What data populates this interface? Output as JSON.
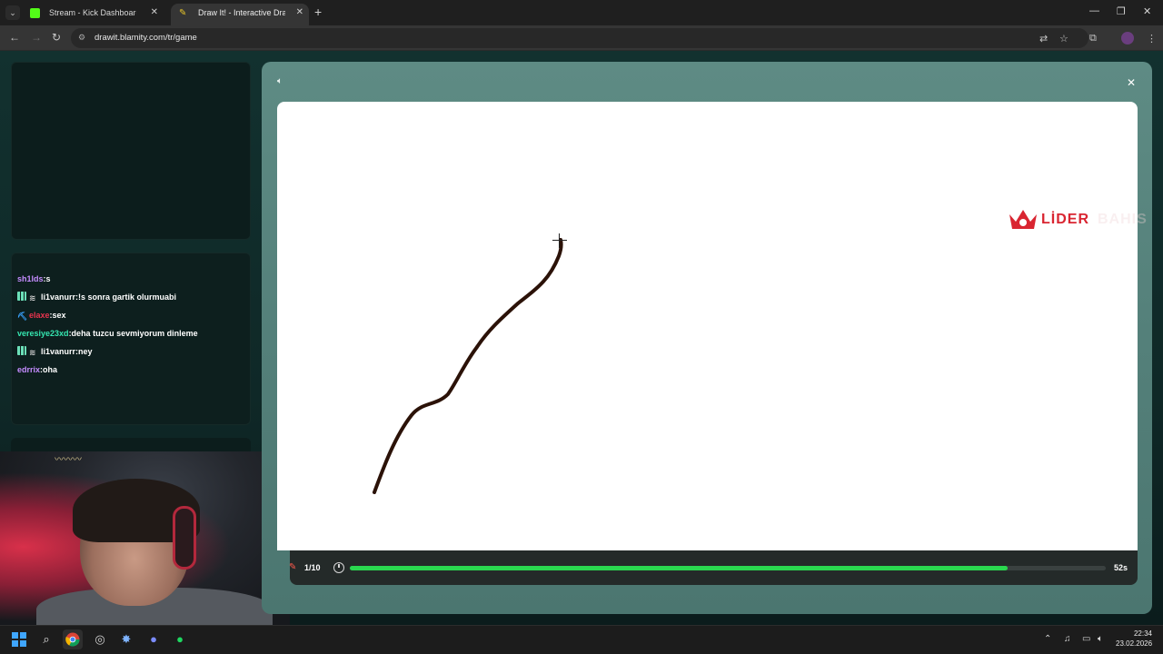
{
  "browser": {
    "tabs": [
      {
        "label": "Stream - Kick Dashboard",
        "active": false
      },
      {
        "label": "Draw It! - Interactive Drawing G",
        "active": true
      }
    ],
    "url": "drawit.blamity.com/tr/game"
  },
  "chat": {
    "messages": [
      {
        "user": "sh1lds",
        "text": ":s",
        "color": "#c58cff",
        "badges": []
      },
      {
        "user": "li1vanurr",
        "text": ":!s sonra gartik olurmuabi",
        "color": "#ffffff",
        "badges": [
          "grid",
          "sub"
        ]
      },
      {
        "user": "elaxe",
        "text": ":sex",
        "color": "#e8344e",
        "badges": [
          "pick"
        ]
      },
      {
        "user": "veresiye23xd",
        "text": ":deha tuzcu sevmiyorum dinleme",
        "color": "#35e6b0",
        "badges": []
      },
      {
        "user": "li1vanurr",
        "text": ":ney",
        "color": "#ffffff",
        "badges": [
          "grid",
          "sub"
        ]
      },
      {
        "user": "edrrix",
        "text": ":oha",
        "color": "#c58cff",
        "badges": []
      }
    ]
  },
  "game": {
    "round": "1/10",
    "time_left": "52s",
    "time_fraction": 0.87,
    "stroke_color": "#2b1208",
    "logo": {
      "part1": "LİDER",
      "part2": "BAHIS"
    }
  },
  "taskbar": {
    "time": "22:34",
    "date": "23.02.2026"
  },
  "colors": {
    "modal": "#5a8780",
    "progress": "#2ad84f",
    "page_bg": "#12312f"
  }
}
